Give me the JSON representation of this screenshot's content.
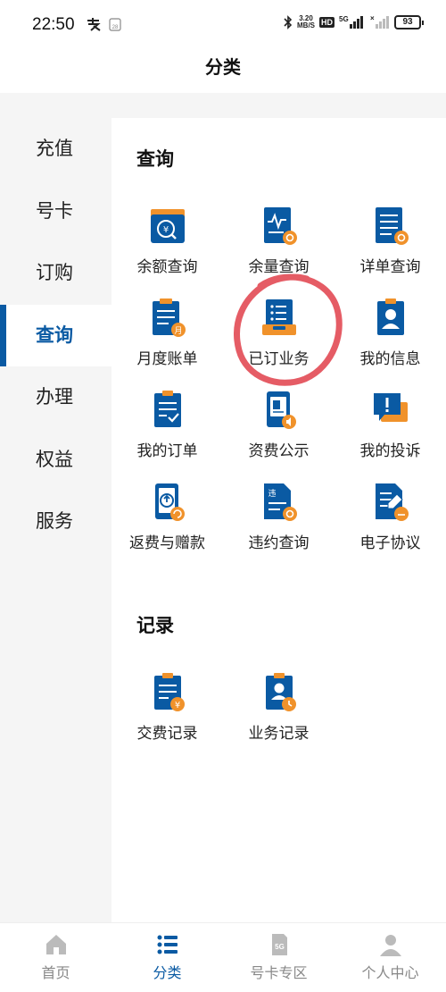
{
  "status_bar": {
    "time": "22:50",
    "speed": "3.20",
    "speed_unit": "MB/S",
    "hd": "HD",
    "network": "5G",
    "battery": "93"
  },
  "header": {
    "title": "分类"
  },
  "sidebar": {
    "items": [
      {
        "label": "充值",
        "active": false
      },
      {
        "label": "号卡",
        "active": false
      },
      {
        "label": "订购",
        "active": false
      },
      {
        "label": "查询",
        "active": true
      },
      {
        "label": "办理",
        "active": false
      },
      {
        "label": "权益",
        "active": false
      },
      {
        "label": "服务",
        "active": false
      }
    ]
  },
  "sections": [
    {
      "title": "查询",
      "items": [
        {
          "label": "余额查询",
          "icon": "wallet-icon"
        },
        {
          "label": "余量查询",
          "icon": "usage-chart-icon"
        },
        {
          "label": "详单查询",
          "icon": "bill-list-icon"
        },
        {
          "label": "月度账单",
          "icon": "monthly-bill-icon"
        },
        {
          "label": "已订业务",
          "icon": "subscribed-service-icon"
        },
        {
          "label": "我的信息",
          "icon": "profile-card-icon"
        },
        {
          "label": "我的订单",
          "icon": "order-check-icon"
        },
        {
          "label": "资费公示",
          "icon": "tariff-notice-icon"
        },
        {
          "label": "我的投诉",
          "icon": "complaint-icon"
        },
        {
          "label": "返费与赠款",
          "icon": "refund-phone-icon"
        },
        {
          "label": "违约查询",
          "icon": "breach-query-icon"
        },
        {
          "label": "电子协议",
          "icon": "e-agreement-icon"
        }
      ]
    },
    {
      "title": "记录",
      "items": [
        {
          "label": "交费记录",
          "icon": "payment-record-icon"
        },
        {
          "label": "业务记录",
          "icon": "service-record-icon"
        }
      ]
    }
  ],
  "bottom_nav": {
    "items": [
      {
        "label": "首页",
        "icon": "home-icon",
        "active": false
      },
      {
        "label": "分类",
        "icon": "category-list-icon",
        "active": true
      },
      {
        "label": "号卡专区",
        "icon": "sim-card-icon",
        "active": false
      },
      {
        "label": "个人中心",
        "icon": "user-icon",
        "active": false
      }
    ]
  },
  "colors": {
    "accent": "#0a5aa3",
    "orange": "#f0922b",
    "annotation": "#e0404a"
  }
}
